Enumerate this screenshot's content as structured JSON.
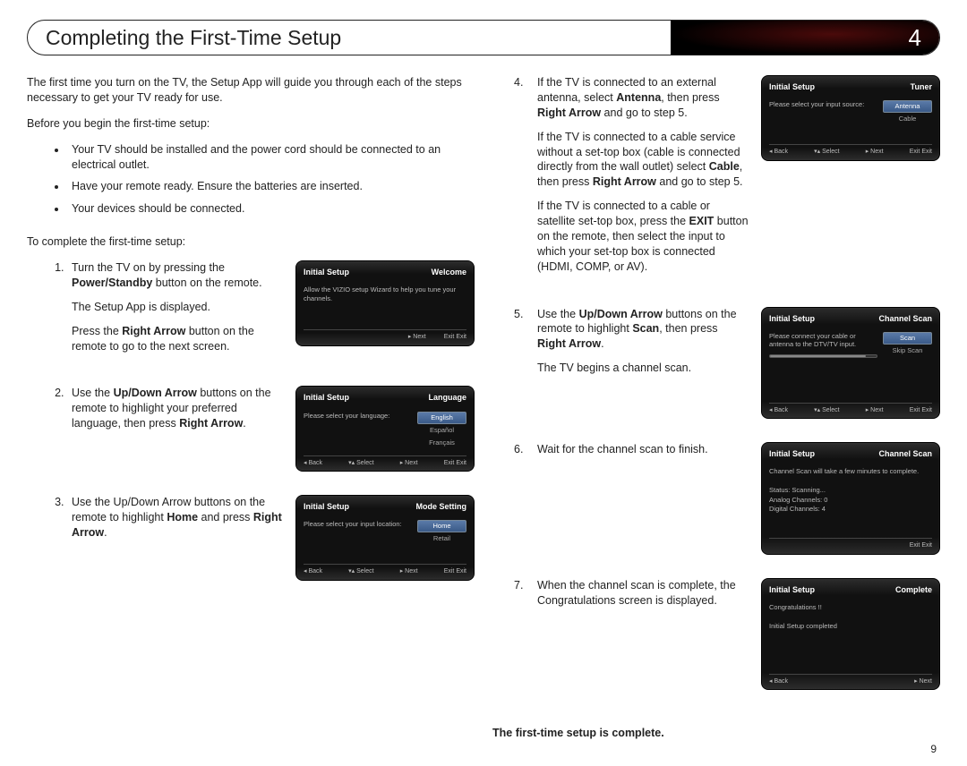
{
  "header": {
    "title": "Completing the First-Time Setup",
    "chapter": "4"
  },
  "intro": "The first time you turn on the TV, the Setup App will guide you through each of the steps necessary to get your TV ready for use.",
  "before_heading": "Before you begin the first-time setup:",
  "before_items": [
    "Your TV should be installed and the power cord should be connected to an electrical outlet.",
    "Have your remote ready. Ensure the batteries are inserted.",
    "Your devices should be connected."
  ],
  "complete_heading": "To complete the first-time setup:",
  "steps": {
    "s1": {
      "p1a": "Turn the TV on by pressing the ",
      "p1b": "Power/Standby",
      "p1c": " button on the remote.",
      "p2": "The Setup App is displayed.",
      "p3a": "Press the ",
      "p3b": "Right Arrow",
      "p3c": " button on the remote to go to the next screen."
    },
    "s2": {
      "a": "Use the ",
      "b": "Up/Down Arrow",
      "c": " buttons on the remote to highlight your preferred language, then press ",
      "d": "Right Arrow",
      "e": "."
    },
    "s3": {
      "a": "Use the Up/Down Arrow buttons on the remote to highlight ",
      "b": "Home",
      "c": " and press ",
      "d": "Right Arrow",
      "e": "."
    },
    "s4": {
      "p1a": "If the TV is connected to an external antenna, select ",
      "p1b": "Antenna",
      "p1c": ", then press ",
      "p1d": "Right Arrow",
      "p1e": " and go to step 5.",
      "p2a": "If the TV is connected to a cable service without a set-top box (cable is connected directly from the wall outlet) select ",
      "p2b": "Cable",
      "p2c": ", then press ",
      "p2d": "Right Arrow",
      "p2e": " and go to step 5.",
      "p3a": "If the TV is connected to a cable or satellite set-top box, press the ",
      "p3b": "EXIT",
      "p3c": " button on the remote, then select the input to which your set-top box is connected (HDMI, COMP, or AV)."
    },
    "s5": {
      "a": "Use the ",
      "b": "Up/Down Arrow",
      "c": " buttons on the remote to highlight ",
      "d": "Scan",
      "e": ", then press ",
      "f": "Right Arrow",
      "g": ".",
      "p2": "The TV begins a channel scan."
    },
    "s6": {
      "a": "Wait for the channel scan to finish."
    },
    "s7": {
      "a": "When the channel scan is complete, the Congratulations screen is displayed."
    }
  },
  "complete_line": "The first-time setup is complete.",
  "page_num": "9",
  "tv": {
    "title": "Initial Setup",
    "foot_back": "◂ Back",
    "foot_select": "▾▴ Select",
    "foot_next": "▸ Next",
    "foot_exit": "Exit Exit",
    "welcome": {
      "sub": "Welcome",
      "msg": "Allow the VIZIO setup Wizard to help you tune your channels."
    },
    "lang": {
      "sub": "Language",
      "msg": "Please select your language:",
      "opts": [
        "English",
        "Español",
        "Français"
      ]
    },
    "mode": {
      "sub": "Mode Setting",
      "msg": "Please select your input location:",
      "opts": [
        "Home",
        "Retail"
      ]
    },
    "tuner": {
      "sub": "Tuner",
      "msg": "Please select your input source:",
      "opts": [
        "Antenna",
        "Cable"
      ]
    },
    "scan": {
      "sub": "Channel Scan",
      "msg": "Please connect your cable or antenna to the DTV/TV input.",
      "opts": [
        "Scan",
        "Skip Scan"
      ]
    },
    "scanning": {
      "sub": "Channel Scan",
      "l1": "Channel Scan will take a few minutes to complete.",
      "l2": "Status: Scanning...",
      "l3": "Analog Channels: 0",
      "l4": "Digital Channels: 4"
    },
    "done": {
      "sub": "Complete",
      "l1": "Congratulations !!",
      "l2": "Initial Setup completed"
    }
  }
}
